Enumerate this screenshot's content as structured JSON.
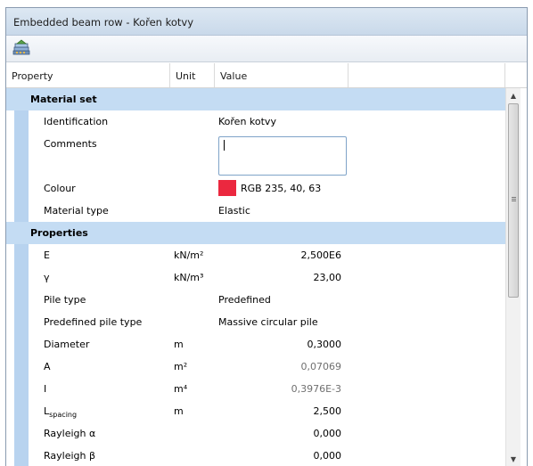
{
  "window": {
    "title": "Embedded beam row - Kořen kotvy"
  },
  "toolbar": {
    "icon": "database-icon"
  },
  "header": {
    "property": "Property",
    "unit": "Unit",
    "value": "Value"
  },
  "sections": {
    "material_set": "Material set",
    "properties": "Properties"
  },
  "material": {
    "identification_label": "Identification",
    "identification_value": "Kořen kotvy",
    "comments_label": "Comments",
    "comments_value": "",
    "colour_label": "Colour",
    "colour_value": "RGB 235, 40, 63",
    "colour_hex": "#eb283f",
    "material_type_label": "Material type",
    "material_type_value": "Elastic"
  },
  "properties": {
    "e": {
      "label": "E",
      "unit": "kN/m²",
      "value": "2,500E6"
    },
    "gamma": {
      "label": "γ",
      "unit": "kN/m³",
      "value": "23,00"
    },
    "pile_type": {
      "label": "Pile type",
      "value": "Predefined"
    },
    "predefined_pile_type": {
      "label": "Predefined pile type",
      "value": "Massive circular pile"
    },
    "diameter": {
      "label": "Diameter",
      "unit": "m",
      "value": "0,3000"
    },
    "a": {
      "label": "A",
      "unit": "m²",
      "value": "0,07069"
    },
    "i": {
      "label": "I",
      "unit": "m⁴",
      "value": "0,3976E-3"
    },
    "l_spacing": {
      "label_main": "L",
      "label_sub": "spacing",
      "unit": "m",
      "value": "2,500"
    },
    "rayleigh_alpha": {
      "label": "Rayleigh α",
      "value": "0,000"
    },
    "rayleigh_beta": {
      "label": "Rayleigh β",
      "value": "0,000"
    }
  },
  "colors": {
    "section_bg": "#c4dcf3",
    "gutter": "#b8d3ef",
    "swatch": "#eb283f"
  }
}
